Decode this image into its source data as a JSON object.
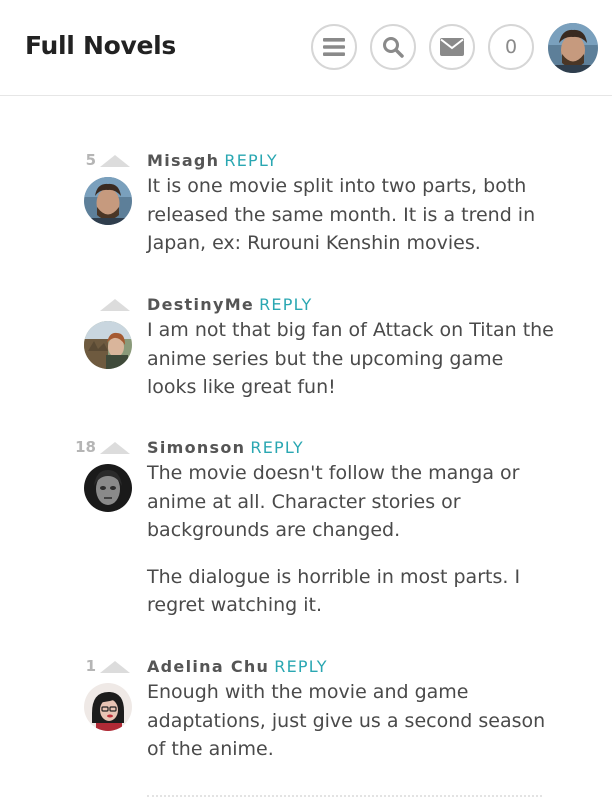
{
  "header": {
    "title": "Full Novels",
    "notification_count": "0",
    "icons": [
      "menu-icon",
      "search-icon",
      "mail-icon"
    ]
  },
  "colors": {
    "accent": "#2aa7b2",
    "vote_arrow": "#dcdcdc",
    "text": "#4a4a4a"
  },
  "comments": [
    {
      "score": "5",
      "author": "Misagh",
      "reply_label": "REPLY",
      "paragraphs": [
        "It is one movie split into two parts, both released the same month. It is a trend in Japan, ex: Rurouni Kenshin movies."
      ]
    },
    {
      "score": "",
      "author": "DestinyMe",
      "reply_label": "REPLY",
      "paragraphs": [
        "I am not that big fan of Attack on Titan the anime series but the upcoming game looks like great fun!"
      ]
    },
    {
      "score": "18",
      "author": "Simonson",
      "reply_label": "REPLY",
      "paragraphs": [
        "The movie doesn't follow the manga or anime at all. Character stories or backgrounds are changed.",
        "The dialogue is horrible in most parts. I regret watching it."
      ]
    },
    {
      "score": "1",
      "author": "Adelina Chu",
      "reply_label": "REPLY",
      "paragraphs": [
        "Enough with the movie and game adaptations, just give us a second season of the anime."
      ]
    }
  ]
}
